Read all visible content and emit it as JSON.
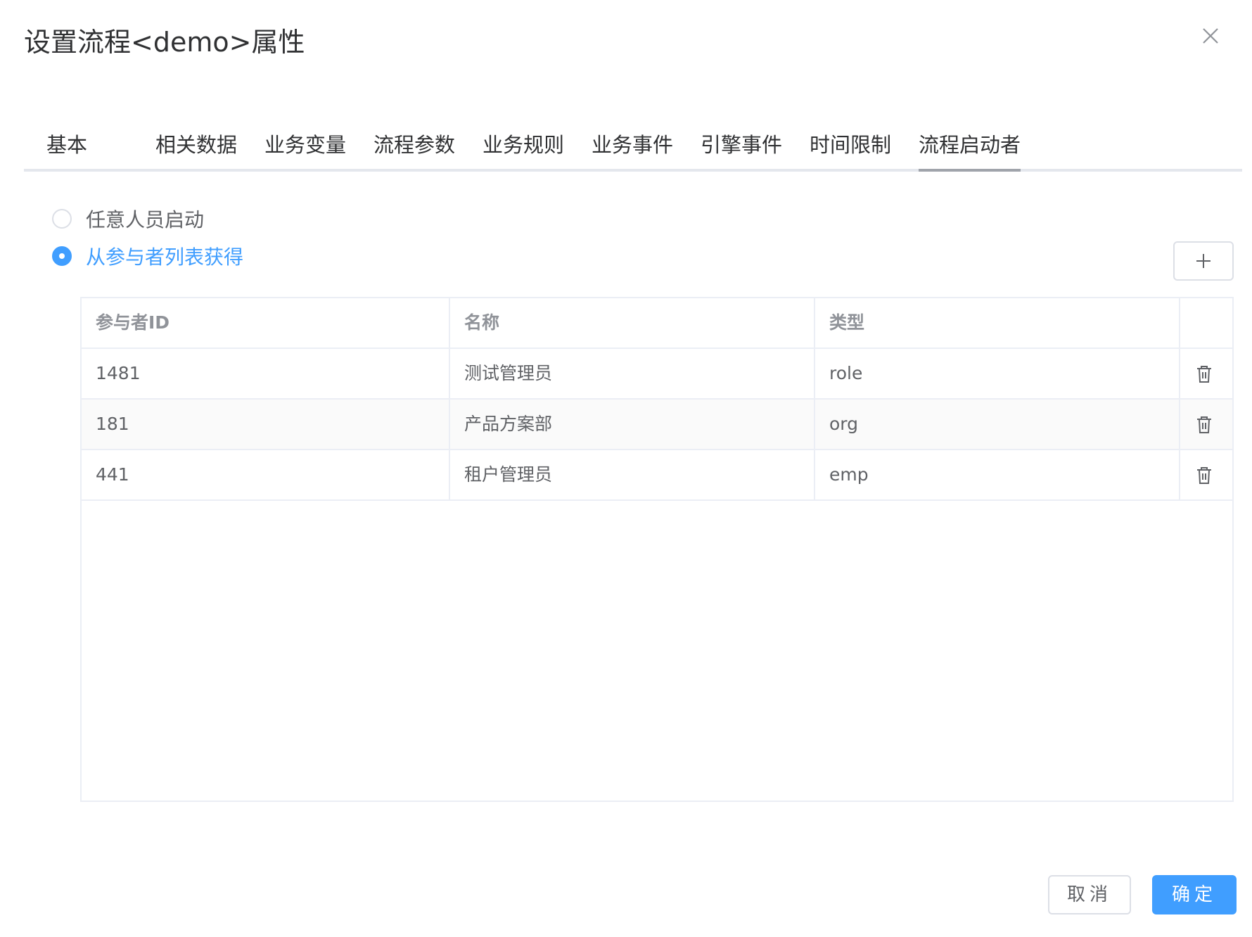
{
  "dialog": {
    "title": "设置流程<demo>属性"
  },
  "tabs": [
    {
      "label": "基本"
    },
    {
      "label": "相关数据"
    },
    {
      "label": "业务变量"
    },
    {
      "label": "流程参数"
    },
    {
      "label": "业务规则"
    },
    {
      "label": "业务事件"
    },
    {
      "label": "引擎事件"
    },
    {
      "label": "时间限制"
    },
    {
      "label": "流程启动者"
    }
  ],
  "active_tab": "流程启动者",
  "starter": {
    "options": [
      {
        "label": "任意人员启动",
        "checked": false
      },
      {
        "label": "从参与者列表获得",
        "checked": true
      }
    ],
    "add_button_icon": "plus-icon"
  },
  "table": {
    "columns": [
      "参与者ID",
      "名称",
      "类型",
      ""
    ],
    "rows": [
      {
        "id": "1481",
        "name": "测试管理员",
        "type": "role"
      },
      {
        "id": "181",
        "name": "产品方案部",
        "type": "org"
      },
      {
        "id": "441",
        "name": "租户管理员",
        "type": "emp"
      }
    ],
    "row_action_icon": "trash-icon"
  },
  "footer": {
    "cancel_label": "取消",
    "ok_label": "确定"
  },
  "colors": {
    "primary": "#409eff",
    "border": "#ebeef5",
    "text": "#303133"
  }
}
